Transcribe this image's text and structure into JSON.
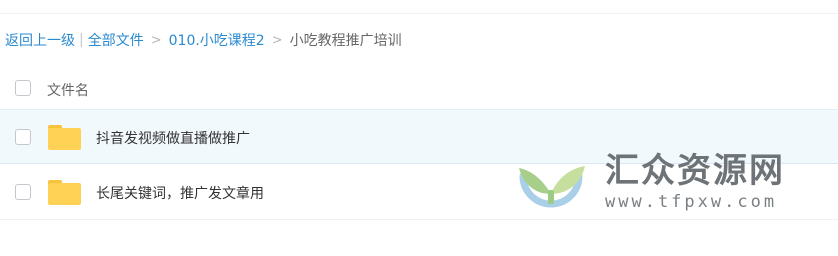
{
  "breadcrumb": {
    "back": "返回上一级",
    "separator": "|",
    "all_files": "全部文件",
    "arrow": ">",
    "course": "010.小吃课程2",
    "current": "小吃教程推广培训"
  },
  "list": {
    "header_label": "文件名",
    "rows": [
      {
        "name": "抖音发视频做直播做推广",
        "type": "folder",
        "selected": true
      },
      {
        "name": "长尾关键词，推广发文章用",
        "type": "folder",
        "selected": false
      }
    ]
  },
  "watermark": {
    "title": "汇众资源网",
    "url": "www.tfpxw.com"
  },
  "colors": {
    "link": "#2a8ad0",
    "folder": "#ffd256",
    "selected_row": "#f1f9fd"
  }
}
